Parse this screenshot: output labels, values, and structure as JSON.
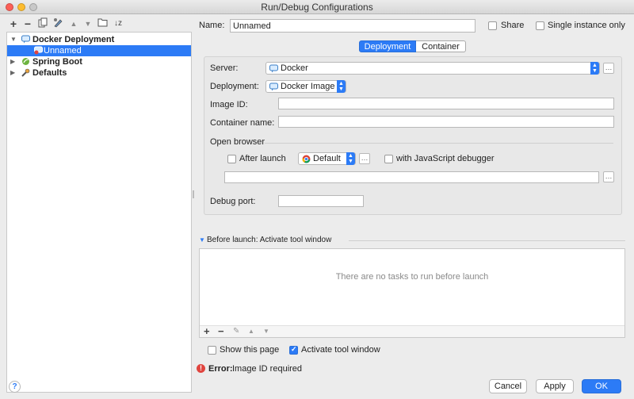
{
  "window": {
    "title": "Run/Debug Configurations"
  },
  "tree_toolbar": {
    "icons": [
      "add-icon",
      "remove-icon",
      "copy-icon",
      "edit-defaults-icon",
      "move-up-icon",
      "move-down-icon",
      "folder-icon",
      "sort-icon"
    ]
  },
  "tree": {
    "items": [
      {
        "label": "Docker Deployment",
        "expanded": true
      },
      {
        "label": "Unnamed",
        "selected": true
      },
      {
        "label": "Spring Boot",
        "expanded": false
      },
      {
        "label": "Defaults",
        "expanded": false
      }
    ]
  },
  "header": {
    "name_label": "Name:",
    "name_value": "Unnamed",
    "share_label": "Share",
    "single_instance_label": "Single instance only"
  },
  "tabs": [
    {
      "label": "Deployment",
      "active": true
    },
    {
      "label": "Container",
      "active": false
    }
  ],
  "deployment": {
    "server_label": "Server:",
    "server_value": "Docker",
    "deployment_label": "Deployment:",
    "deployment_value": "Docker Image",
    "image_id_label": "Image ID:",
    "image_id_value": "",
    "container_name_label": "Container name:",
    "container_name_value": "",
    "open_browser_label": "Open browser",
    "after_launch_label": "After launch",
    "browser_value": "Default",
    "js_debugger_label": "with JavaScript debugger",
    "url_value": "",
    "debug_port_label": "Debug port:",
    "debug_port_value": ""
  },
  "before_launch": {
    "header": "Before launch: Activate tool window",
    "empty_text": "There are no tasks to run before launch",
    "toolbar_icons": [
      "add-icon",
      "remove-icon",
      "edit-icon",
      "move-up-icon",
      "move-down-icon"
    ]
  },
  "options": {
    "show_this_page_label": "Show this page",
    "show_this_page_checked": false,
    "activate_tool_window_label": "Activate tool window",
    "activate_tool_window_checked": true
  },
  "error": {
    "prefix": "Error:",
    "message": "Image ID required"
  },
  "footer": {
    "help_label": "?",
    "cancel_label": "Cancel",
    "apply_label": "Apply",
    "ok_label": "OK"
  },
  "colors": {
    "accent": "#2c7bf6",
    "selection": "#2c7bf6",
    "error": "#e0443e"
  }
}
